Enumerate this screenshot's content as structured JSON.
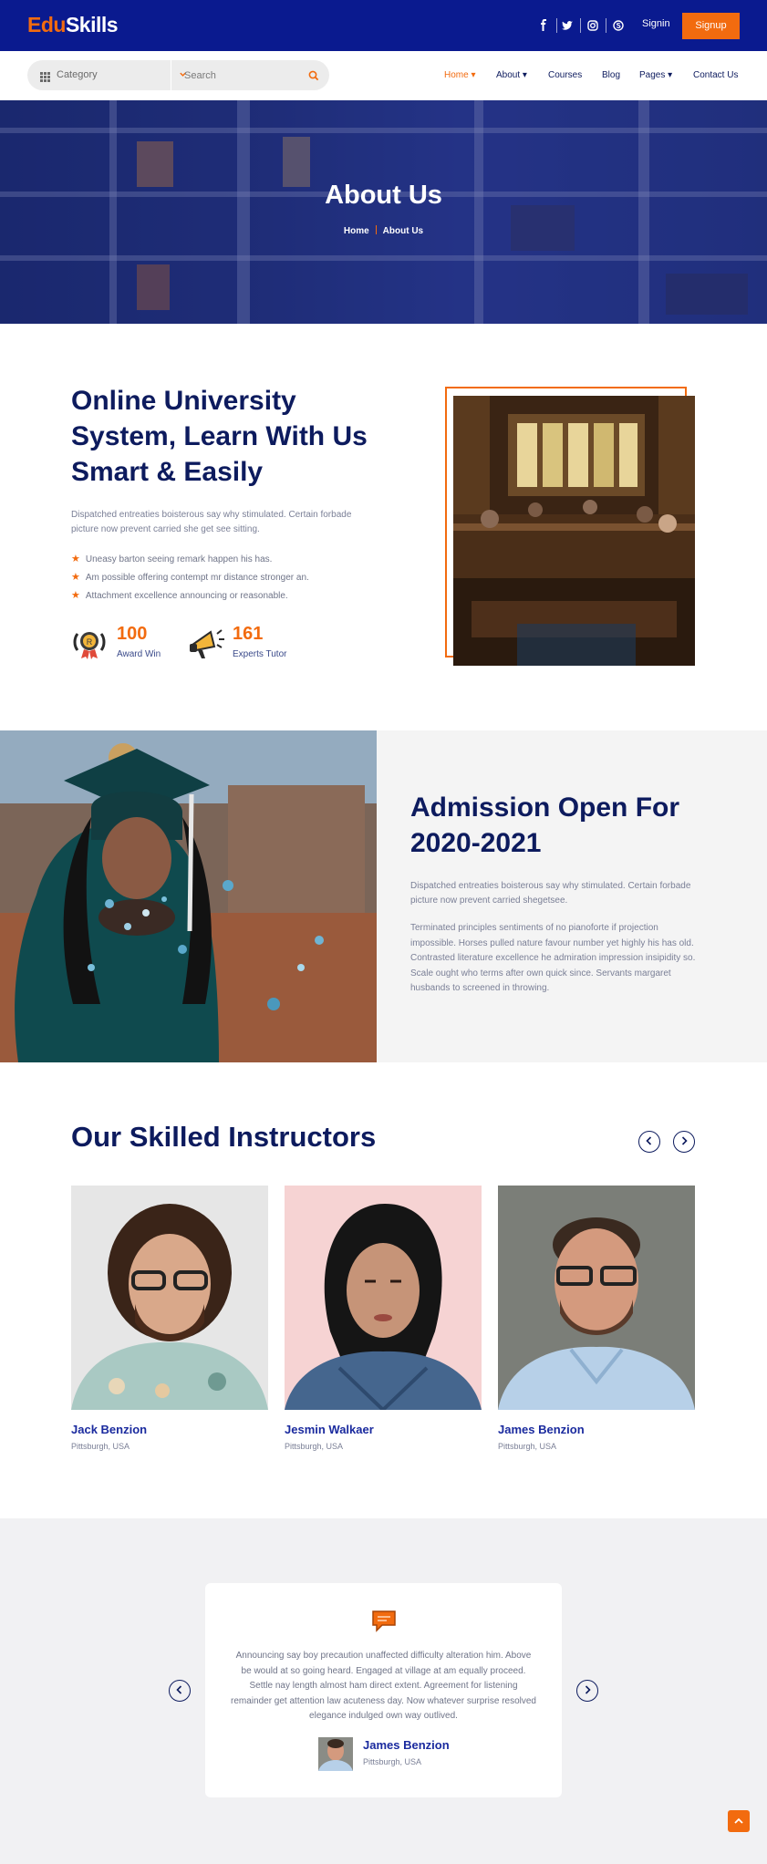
{
  "brand": {
    "part1": "Edu",
    "part2": "Skills",
    "accent": "#f26b0f",
    "primary": "#0a1a8f"
  },
  "topbar": {
    "social": [
      {
        "icon": "facebook-icon",
        "glyph": "f"
      },
      {
        "icon": "twitter-icon",
        "glyph": "🐦"
      },
      {
        "icon": "instagram-icon",
        "glyph": "◎"
      },
      {
        "icon": "skype-icon",
        "glyph": "S"
      }
    ],
    "signin": "Signin",
    "signup": "Signup"
  },
  "search": {
    "category": "Category",
    "placeholder": "Search"
  },
  "nav": {
    "items": [
      {
        "label": "Home ▾"
      },
      {
        "label": "About ▾"
      },
      {
        "label": "Courses"
      },
      {
        "label": "Blog"
      },
      {
        "label": "Pages ▾"
      },
      {
        "label": "Contact Us"
      }
    ]
  },
  "hero": {
    "title": "About Us",
    "breadcrumb_home": "Home",
    "breadcrumb_current": "About Us"
  },
  "about": {
    "title": "Online University System, Learn With Us Smart & Easily",
    "text": "Dispatched entreaties boisterous say why stimulated. Certain forbade picture now prevent carried she get see sitting.",
    "bullets": [
      "Uneasy barton seeing remark happen his has.",
      "Am possible offering contempt mr distance stronger an.",
      "Attachment excellence announcing or reasonable."
    ],
    "stats": [
      {
        "value": "100",
        "label": "Award Win",
        "icon": "award-medal-icon"
      },
      {
        "value": "161",
        "label": "Experts Tutor",
        "icon": "megaphone-icon"
      }
    ]
  },
  "admission": {
    "title": "Admission Open For 2020-2021",
    "text1": "Dispatched entreaties boisterous say why stimulated. Certain forbade picture now prevent carried shegetsee.",
    "text2": "Terminated principles sentiments of no pianoforte if projection impossible. Horses pulled nature favour number yet highly his has old. Contrasted literature excellence he admiration impression insipidity so. Scale ought who terms after own quick since. Servants margaret husbands to screened in throwing."
  },
  "instructors": {
    "title": "Our Skilled Instructors",
    "items": [
      {
        "name": "Jack Benzion",
        "location": "Pittsburgh, USA"
      },
      {
        "name": "Jesmin Walkaer",
        "location": "Pittsburgh, USA"
      },
      {
        "name": "James Benzion",
        "location": "Pittsburgh, USA"
      }
    ]
  },
  "testimonial": {
    "text": "Announcing say boy precaution unaffected difficulty alteration him. Above be would at so going heard. Engaged at village at am equally proceed. Settle nay length almost ham direct extent. Agreement for listening remainder get attention law acuteness day. Now whatever surprise resolved elegance indulged own way outlived.",
    "name": "James Benzion",
    "location": "Pittsburgh, USA"
  }
}
